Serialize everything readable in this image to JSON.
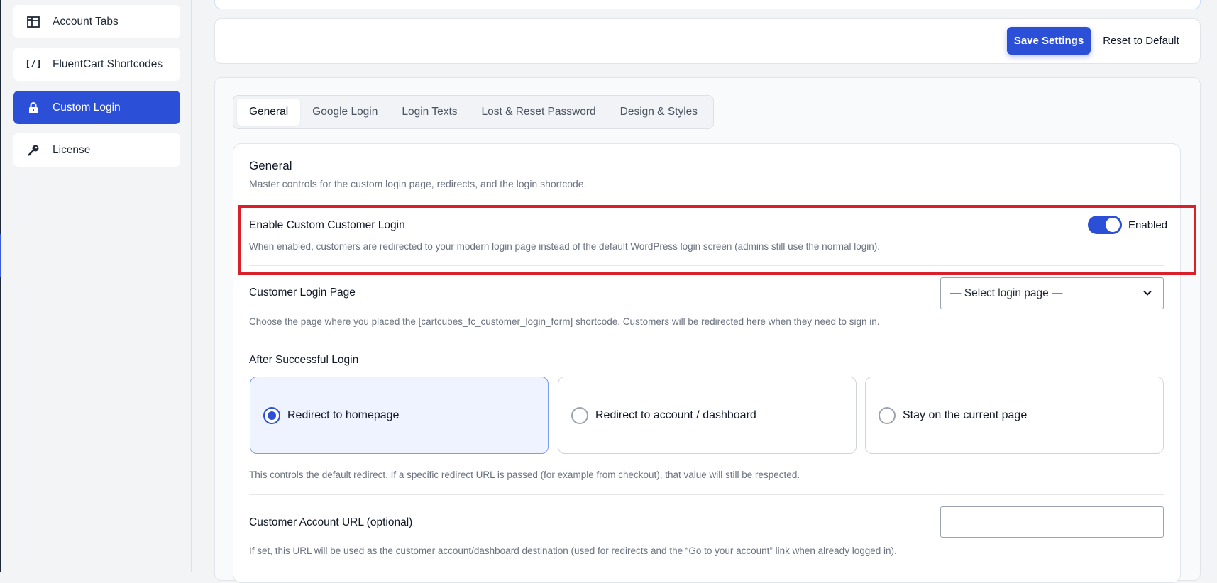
{
  "sidebar": {
    "items": [
      {
        "label": "Account Tabs",
        "icon": "layout-icon",
        "active": false
      },
      {
        "label": "FluentCart Shortcodes",
        "icon": "shortcode-icon",
        "active": false
      },
      {
        "label": "Custom Login",
        "icon": "lock-icon",
        "active": true
      },
      {
        "label": "License",
        "icon": "key-icon",
        "active": false
      }
    ]
  },
  "actions": {
    "save_label": "Save Settings",
    "reset_label": "Reset to Default"
  },
  "tabs": [
    {
      "label": "General",
      "active": true
    },
    {
      "label": "Google Login",
      "active": false
    },
    {
      "label": "Login Texts",
      "active": false
    },
    {
      "label": "Lost & Reset Password",
      "active": false
    },
    {
      "label": "Design & Styles",
      "active": false
    }
  ],
  "general": {
    "title": "General",
    "description": "Master controls for the custom login page, redirects, and the login shortcode.",
    "enable_login": {
      "label": "Enable Custom Customer Login",
      "help": "When enabled, customers are redirected to your modern login page instead of the default WordPress login screen (admins still use the normal login).",
      "state_label": "Enabled",
      "enabled": true
    },
    "login_page": {
      "label": "Customer Login Page",
      "selected": "— Select login page —",
      "help": "Choose the page where you placed the [cartcubes_fc_customer_login_form] shortcode. Customers will be redirected here when they need to sign in."
    },
    "after_login": {
      "label": "After Successful Login",
      "options": [
        {
          "label": "Redirect to homepage",
          "selected": true
        },
        {
          "label": "Redirect to account / dashboard",
          "selected": false
        },
        {
          "label": "Stay on the current page",
          "selected": false
        }
      ],
      "help": "This controls the default redirect. If a specific redirect URL is passed (for example from checkout), that value will still be respected."
    },
    "account_url": {
      "label": "Customer Account URL (optional)",
      "value": "",
      "help": "If set, this URL will be used as the customer account/dashboard destination (used for redirects and the “Go to your account” link when already logged in)."
    }
  },
  "colors": {
    "accent": "#2c4fd8",
    "highlight_box": "#d9202a"
  }
}
